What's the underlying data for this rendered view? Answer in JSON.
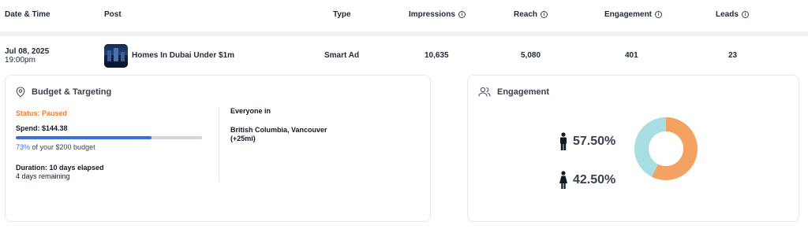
{
  "table": {
    "headers": {
      "date": "Date & Time",
      "post": "Post",
      "type": "Type",
      "impressions": "Impressions",
      "reach": "Reach",
      "engagement": "Engagement",
      "leads": "Leads"
    },
    "row": {
      "date": "Jul 08, 2025",
      "time": "19:00pm",
      "post_title": "Homes In Dubai Under $1m",
      "type": "Smart Ad",
      "impressions": "10,635",
      "reach": "5,080",
      "engagement": "401",
      "leads": "23"
    }
  },
  "budget_card": {
    "title": "Budget & Targeting",
    "status": "Status: Paused",
    "spend": "Spend: $144.38",
    "budget_pct": "73%",
    "budget_rest": " of your $200 budget",
    "budget_fraction": 0.73,
    "duration": "Duration: 10 days elapsed",
    "remaining": "4 days remaining",
    "audience_head": "Everyone in",
    "audience_loc_line1": "British Columbia, Vancouver",
    "audience_loc_line2": "(+25mi)"
  },
  "engagement_card": {
    "title": "Engagement",
    "male_pct": "57.50%",
    "female_pct": "42.50%",
    "male_value": 57.5,
    "female_value": 42.5,
    "colors": {
      "male": "#f4a261",
      "female": "#a8dde1"
    }
  },
  "icons": {
    "info": "info-icon",
    "location": "location-pin-icon",
    "people": "people-icon",
    "male": "male-icon",
    "female": "female-icon"
  }
}
